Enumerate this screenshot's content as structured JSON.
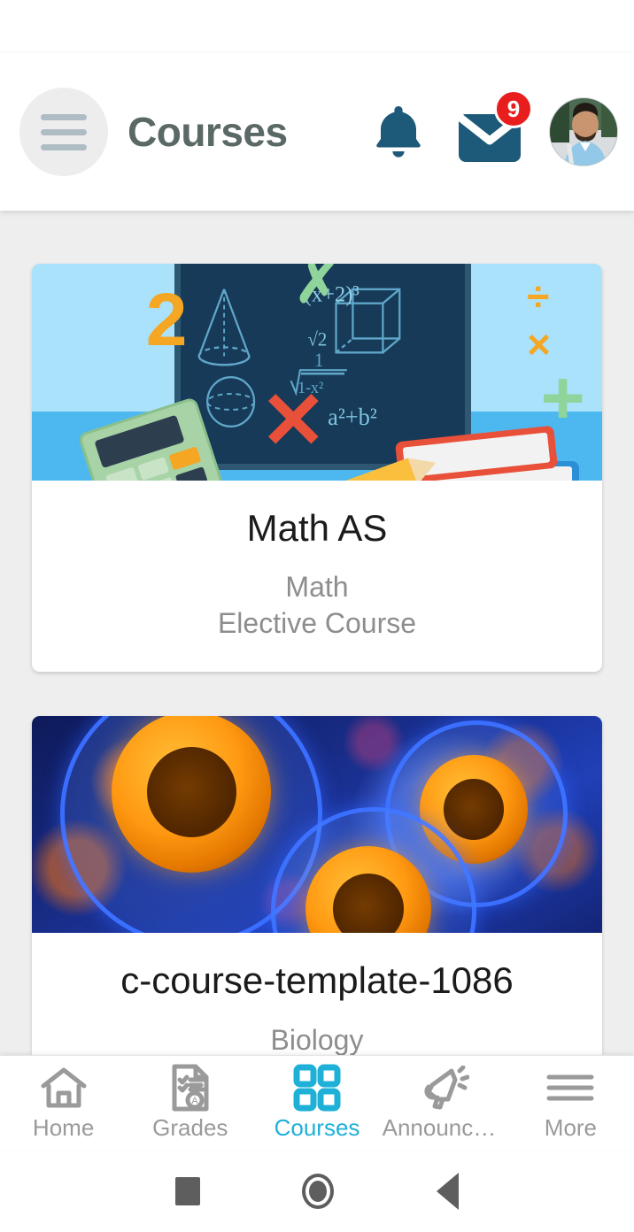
{
  "app": {
    "title": "Courses"
  },
  "header": {
    "menu_icon": "hamburger-menu-icon",
    "title": "Courses",
    "notifications_icon": "bell-icon",
    "inbox_icon": "mail-envelope-icon",
    "inbox_badge_count": "9",
    "avatar": "user-profile-avatar",
    "accent_color": "#1d5979",
    "badge_color": "#e81e1e"
  },
  "courses": [
    {
      "image": "math-chalkboard-illustration",
      "title": "Math AS",
      "subject": "Math",
      "type": "Elective Course"
    },
    {
      "image": "biology-cells-microscope-photo",
      "title": "c-course-template-1086",
      "subject": "Biology",
      "type": ""
    }
  ],
  "bottom_nav": {
    "active": "Courses",
    "active_color": "#1fb0d8",
    "inactive_color": "#9a9a9a",
    "items": [
      {
        "label": "Home",
        "icon": "home-icon"
      },
      {
        "label": "Grades",
        "icon": "grades-document-icon"
      },
      {
        "label": "Courses",
        "icon": "courses-grid-icon"
      },
      {
        "label": "Announce…",
        "icon": "megaphone-icon"
      },
      {
        "label": "More",
        "icon": "more-lines-icon"
      }
    ]
  },
  "system_nav": {
    "recents": "square-recents-icon",
    "home": "circle-home-icon",
    "back": "triangle-back-icon"
  }
}
